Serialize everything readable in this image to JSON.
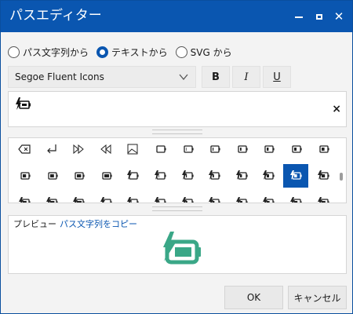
{
  "window": {
    "title": "パスエディター"
  },
  "source": {
    "options": [
      {
        "label": "パス文字列から",
        "checked": false
      },
      {
        "label": "テキストから",
        "checked": true
      },
      {
        "label": "SVG から",
        "checked": false
      }
    ]
  },
  "font": {
    "family_value": "Segoe Fluent Icons"
  },
  "style_buttons": {
    "bold": "B",
    "italic": "I",
    "underline": "U"
  },
  "input": {
    "glyph_icon": "battery-charging-icon",
    "clear_label": "×"
  },
  "glyph_grid": {
    "rows": [
      [
        "backspace-icon",
        "enter-icon",
        "fast-forward-icon",
        "rewind-icon",
        "image-frame-icon",
        "battery-0-icon",
        "battery-1-icon",
        "battery-2-icon",
        "battery-3-icon",
        "battery-4-icon",
        "battery-5-icon",
        "battery-6-icon"
      ],
      [
        "battery-7-icon",
        "battery-8-icon",
        "battery-9-icon",
        "battery-10-icon",
        "battery-charging-0-icon",
        "battery-charging-1-icon",
        "battery-charging-2-icon",
        "battery-charging-3-icon",
        "battery-charging-4-icon",
        "battery-charging-5-icon",
        "battery-charging-6-icon",
        "battery-charging-7-icon"
      ],
      [
        "battery-charging-8-icon",
        "battery-charging-9-icon",
        "battery-charging-10-icon",
        "battery-saver-0-icon",
        "battery-saver-1-icon",
        "battery-saver-2-icon",
        "battery-saver-3-icon",
        "battery-saver-4-icon",
        "battery-saver-5-icon",
        "battery-saver-6-icon",
        "battery-saver-7-icon",
        "battery-saver-8-icon"
      ]
    ],
    "selected_row": 1,
    "selected_col": 10,
    "accent_color": "#0a56b0"
  },
  "preview": {
    "label": "プレビュー",
    "copy_link": "パス文字列をコピー",
    "icon": "battery-charging-icon",
    "icon_color": "#3aa787"
  },
  "buttons": {
    "ok": "OK",
    "cancel": "キャンセル"
  }
}
